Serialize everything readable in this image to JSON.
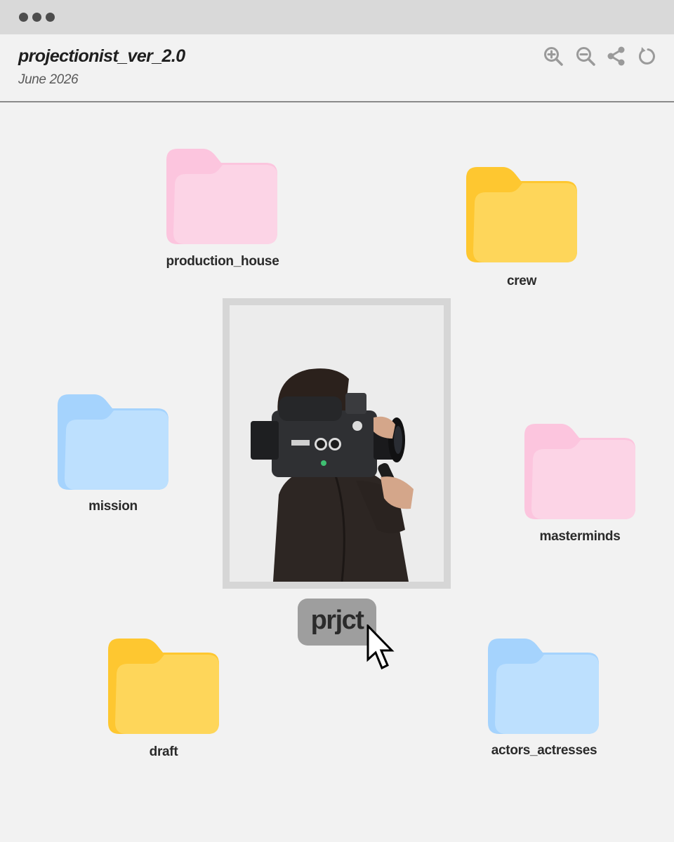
{
  "window": {
    "title": "projectionist_ver_2.0",
    "date": "June 2026"
  },
  "toolbar": {
    "buttons": [
      {
        "icon": "zoom-in-icon"
      },
      {
        "icon": "zoom-out-icon"
      },
      {
        "icon": "share-icon"
      },
      {
        "icon": "refresh-icon"
      }
    ],
    "icon_color": "#9a9a9a"
  },
  "folders": [
    {
      "name": "production_house",
      "color": "pink"
    },
    {
      "name": "crew",
      "color": "yellow"
    },
    {
      "name": "mission",
      "color": "blue"
    },
    {
      "name": "masterminds",
      "color": "pink"
    },
    {
      "name": "draft",
      "color": "yellow"
    },
    {
      "name": "actors_actresses",
      "color": "blue"
    }
  ],
  "colors": {
    "pink_back": "#fcc5de",
    "pink_front": "#fcd4e6",
    "yellow_back": "#fec730",
    "yellow_front": "#fed65a",
    "blue_back": "#a5d3fd",
    "blue_front": "#bde0fe",
    "titlebar": "#d9d9d9",
    "background": "#f2f2f2"
  },
  "center": {
    "photo_subject": "person holding vintage film camera",
    "tag_label": "prjct"
  }
}
